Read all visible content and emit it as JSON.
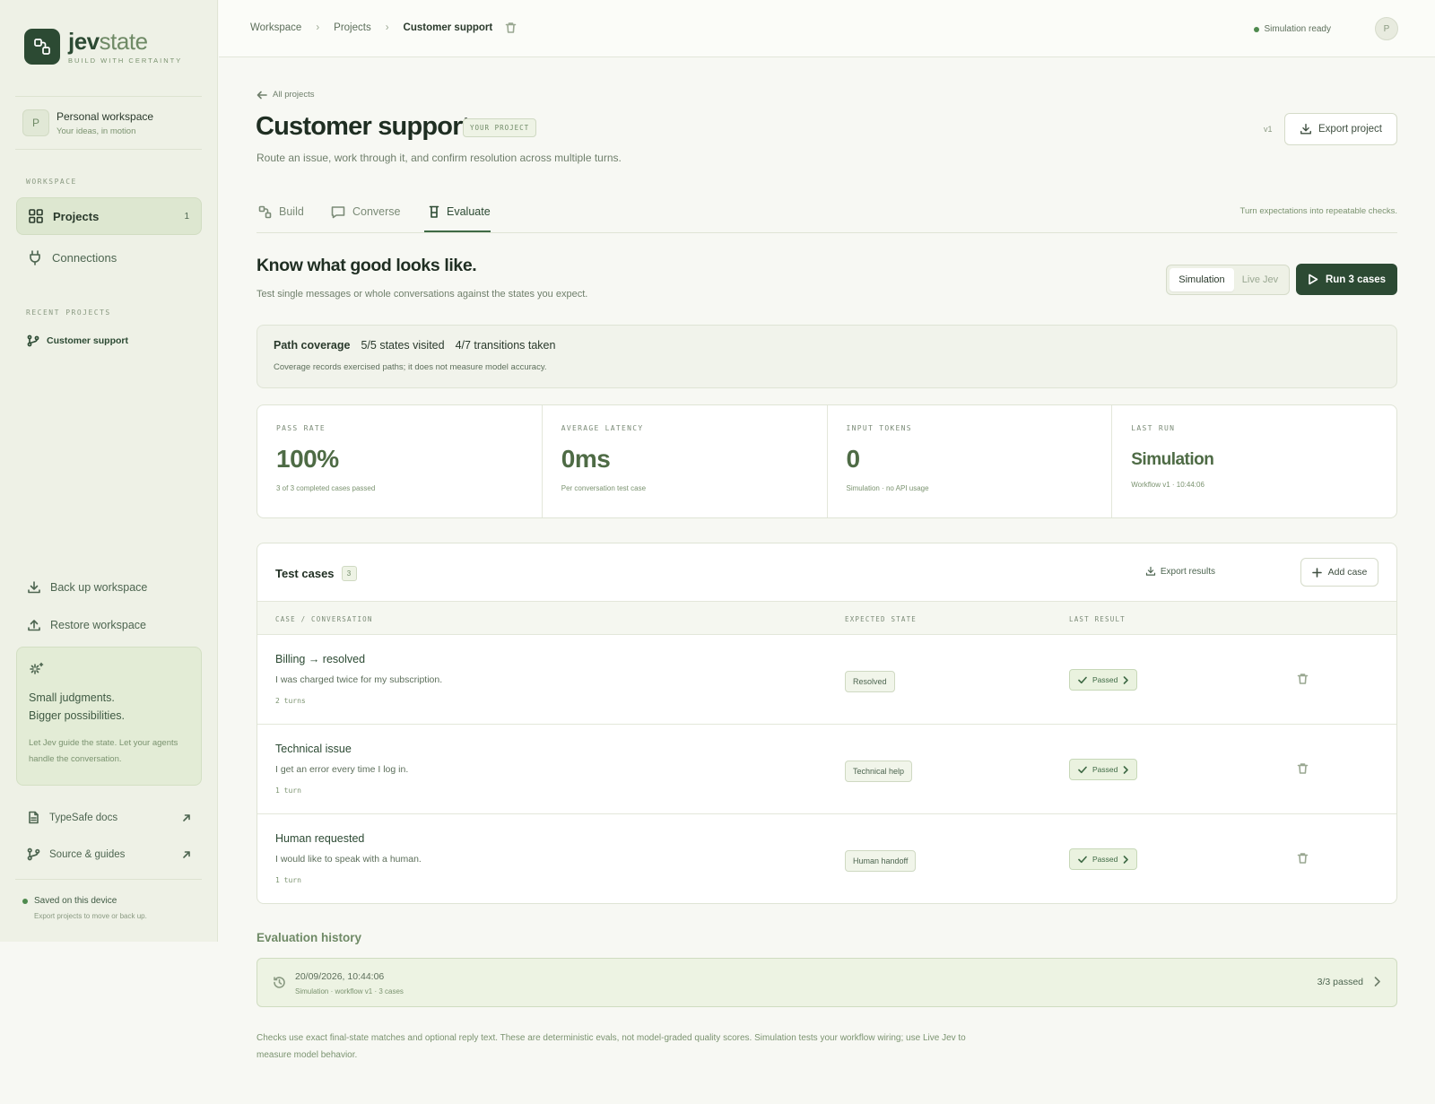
{
  "brand": {
    "name_bold": "jev",
    "name_light": "state",
    "tagline": "BUILD WITH CERTAINTY"
  },
  "workspace": {
    "avatar": "P",
    "name": "Personal workspace",
    "sub": "Your ideas, in motion"
  },
  "sidebar": {
    "section_workspace": "WORKSPACE",
    "nav": [
      {
        "label": "Projects",
        "count": "1",
        "icon": "grid-icon"
      },
      {
        "label": "Connections",
        "icon": "plug-icon"
      }
    ],
    "section_recent": "RECENT PROJECTS",
    "recent": [
      {
        "label": "Customer support",
        "icon": "branch-icon"
      }
    ],
    "backup": "Back up workspace",
    "restore": "Restore workspace",
    "promo": {
      "line1": "Small judgments.",
      "line2": "Bigger possibilities.",
      "body": "Let Jev guide the state. Let your agents handle the conversation."
    },
    "links": [
      {
        "label": "TypeSafe docs",
        "icon": "doc-icon"
      },
      {
        "label": "Source & guides",
        "icon": "branch-icon"
      }
    ],
    "saved": {
      "label": "Saved on this device",
      "sub": "Export projects to move or back up."
    }
  },
  "topbar": {
    "crumbs": [
      "Workspace",
      "Projects",
      "Customer support"
    ],
    "status": "Simulation ready",
    "avatar": "P"
  },
  "project": {
    "back": "All projects",
    "title": "Customer support",
    "badge": "YOUR PROJECT",
    "description": "Route an issue, work through it, and confirm resolution across multiple turns.",
    "version": "v1",
    "export_label": "Export project"
  },
  "tabs": {
    "items": [
      {
        "label": "Build",
        "icon": "build-icon"
      },
      {
        "label": "Converse",
        "icon": "chat-icon"
      },
      {
        "label": "Evaluate",
        "icon": "beaker-icon",
        "active": true
      }
    ],
    "hint": "Turn expectations into repeatable checks."
  },
  "evaluate": {
    "heading": "Know what good looks like.",
    "sub": "Test single messages or whole conversations against the states you expect.",
    "mode_options": [
      "Simulation",
      "Live Jev"
    ],
    "mode_selected": "Simulation",
    "run_label": "Run 3 cases"
  },
  "coverage": {
    "label": "Path coverage",
    "states": "5/5 states visited",
    "transitions": "4/7 transitions taken",
    "note": "Coverage records exercised paths; it does not measure model accuracy."
  },
  "stats": [
    {
      "label": "PASS RATE",
      "value": "100%",
      "note": "3 of 3 completed cases passed"
    },
    {
      "label": "AVERAGE LATENCY",
      "value": "0ms",
      "note": "Per conversation test case"
    },
    {
      "label": "INPUT TOKENS",
      "value": "0",
      "note": "Simulation · no API usage"
    },
    {
      "label": "LAST RUN",
      "value": "Simulation",
      "note": "Workflow v1 · 10:44:06"
    }
  ],
  "cases": {
    "title": "Test cases",
    "count": "3",
    "export_results": "Export results",
    "add_case": "Add case",
    "columns": [
      "CASE / CONVERSATION",
      "EXPECTED STATE",
      "LAST RESULT"
    ],
    "rows": [
      {
        "title": "Billing → resolved",
        "message": "I was charged twice for my subscription.",
        "turns": "2 turns",
        "expected": "Resolved",
        "result": "Passed"
      },
      {
        "title": "Technical issue",
        "message": "I get an error every time I log in.",
        "turns": "1 turn",
        "expected": "Technical help",
        "result": "Passed"
      },
      {
        "title": "Human requested",
        "message": "I would like to speak with a human.",
        "turns": "1 turn",
        "expected": "Human handoff",
        "result": "Passed"
      }
    ]
  },
  "history": {
    "heading": "Evaluation history",
    "entry": {
      "date": "20/09/2026, 10:44:06",
      "sub": "Simulation · workflow v1 · 3 cases",
      "result": "3/3 passed"
    }
  },
  "footnote": "Checks use exact final-state matches and optional reply text. These are deterministic evals, not model-graded quality scores. Simulation tests your workflow wiring; use Live Jev to measure model behavior.",
  "colors": {
    "accent": "#2c4a33",
    "pass": "#3f6a45",
    "sidebar_bg": "#eef1e6"
  }
}
